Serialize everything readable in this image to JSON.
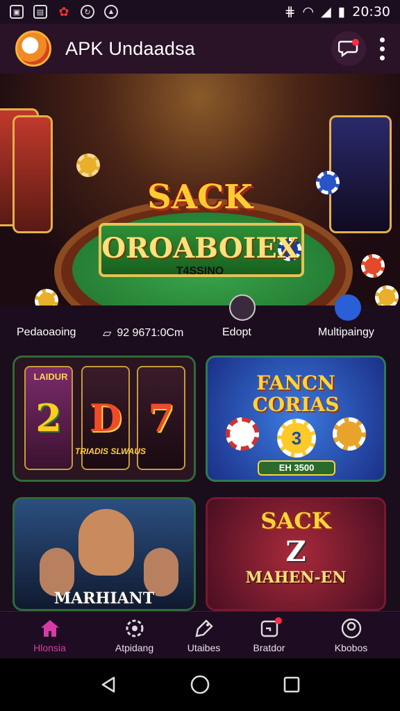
{
  "status": {
    "time": "20:30"
  },
  "app": {
    "title": "APK Undaadsa"
  },
  "hero": {
    "line1": "SACK",
    "line2": "OROABOIEX",
    "line3": "T4SSINO"
  },
  "quick": {
    "item1": "Pedaoaoing",
    "item2": "92 9671:0Cm",
    "item3": "Edopt",
    "item4": "Multipaingy"
  },
  "cards": [
    {
      "title": "",
      "reel1": "2",
      "reel2": "D",
      "reel3": "7",
      "sub1": "LAIDUR",
      "sub2": "TRIADIS SLWAUS"
    },
    {
      "title": "FANCN CORIAS",
      "badge": "3",
      "price": "EH 3500"
    },
    {
      "title": "MARHIANT"
    },
    {
      "title": "SACK",
      "num": "Z",
      "subtitle": "MAHEN-EN"
    }
  ],
  "nav": {
    "home": "Hlonsia",
    "item2": "Atpidang",
    "item3": "Utaibes",
    "item4": "Bratdor",
    "item5": "Kbobos"
  },
  "colors": {
    "accent": "#d63ba8",
    "badge": "#ff2b40"
  }
}
